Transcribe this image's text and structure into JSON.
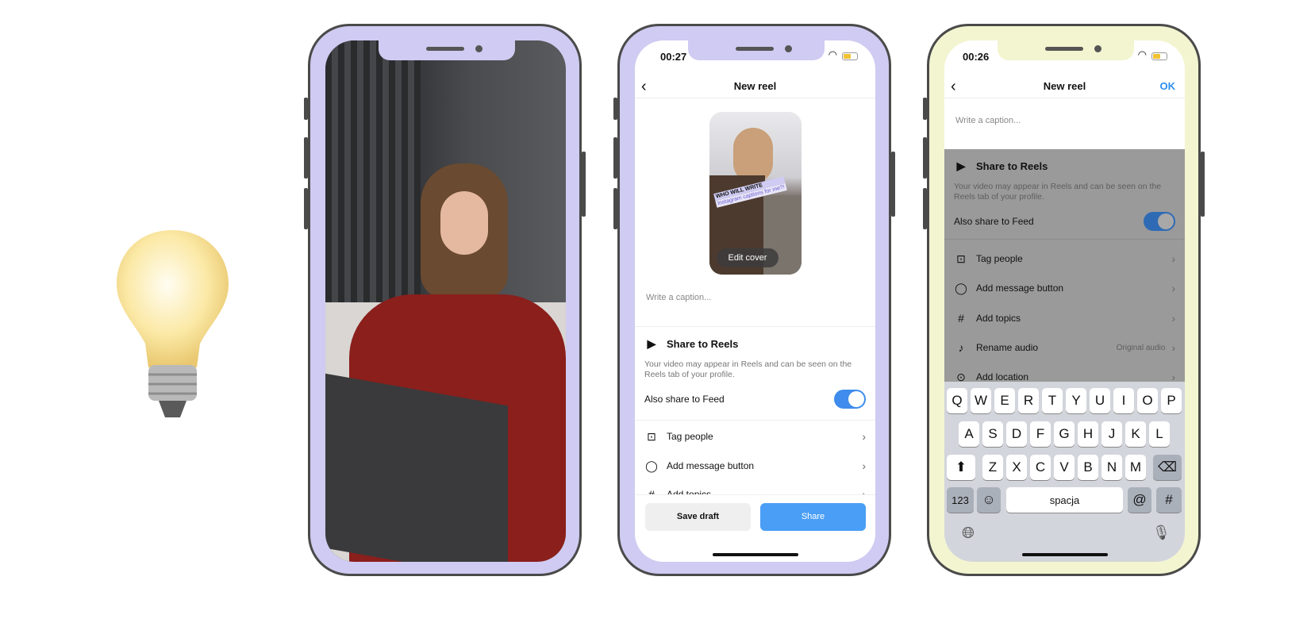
{
  "colors": {
    "phone_frame_lavender": "#cfcbf2",
    "phone_frame_yellow": "#f3f5d0",
    "share_blue": "#4a9ef5",
    "toggle_blue": "#3f8cec"
  },
  "decor": {
    "lightbulb_icon": "lightbulb"
  },
  "phone2": {
    "status_time": "00:27",
    "title": "New reel",
    "cover_sticker_line1": "WHO WILL WRITE",
    "cover_sticker_line2": "Instagram captions for me?!",
    "edit_cover": "Edit cover",
    "caption_placeholder": "Write a caption...",
    "share_to_reels": "Share to Reels",
    "reels_description": "Your video may appear in Reels and can be seen on the Reels tab of your profile.",
    "also_share_feed": "Also share to Feed",
    "also_share_feed_on": true,
    "items": [
      {
        "label": "Tag people",
        "icon": "tag-person"
      },
      {
        "label": "Add message button",
        "icon": "speech-bubble"
      },
      {
        "label": "Add topics",
        "icon": "hashtag"
      }
    ],
    "save_draft": "Save draft",
    "share": "Share"
  },
  "phone3": {
    "status_time": "00:26",
    "title": "New reel",
    "ok": "OK",
    "caption_placeholder": "Write a caption...",
    "share_to_reels": "Share to Reels",
    "reels_description": "Your video may appear in Reels and can be seen on the Reels tab of your profile.",
    "also_share_feed": "Also share to Feed",
    "also_share_feed_on": true,
    "items": [
      {
        "label": "Tag people",
        "icon": "tag-person"
      },
      {
        "label": "Add message button",
        "icon": "speech-bubble"
      },
      {
        "label": "Add topics",
        "icon": "hashtag"
      },
      {
        "label": "Rename audio",
        "icon": "music-note",
        "value": "Original audio"
      },
      {
        "label": "Add location",
        "icon": "location-pin"
      }
    ],
    "keyboard": {
      "row1": [
        "Q",
        "W",
        "E",
        "R",
        "T",
        "Y",
        "U",
        "I",
        "O",
        "P"
      ],
      "row2": [
        "A",
        "S",
        "D",
        "F",
        "G",
        "H",
        "J",
        "K",
        "L"
      ],
      "row3": [
        "Z",
        "X",
        "C",
        "V",
        "B",
        "N",
        "M"
      ],
      "numbers": "123",
      "space": "spacja",
      "at": "@",
      "hash": "#"
    }
  }
}
